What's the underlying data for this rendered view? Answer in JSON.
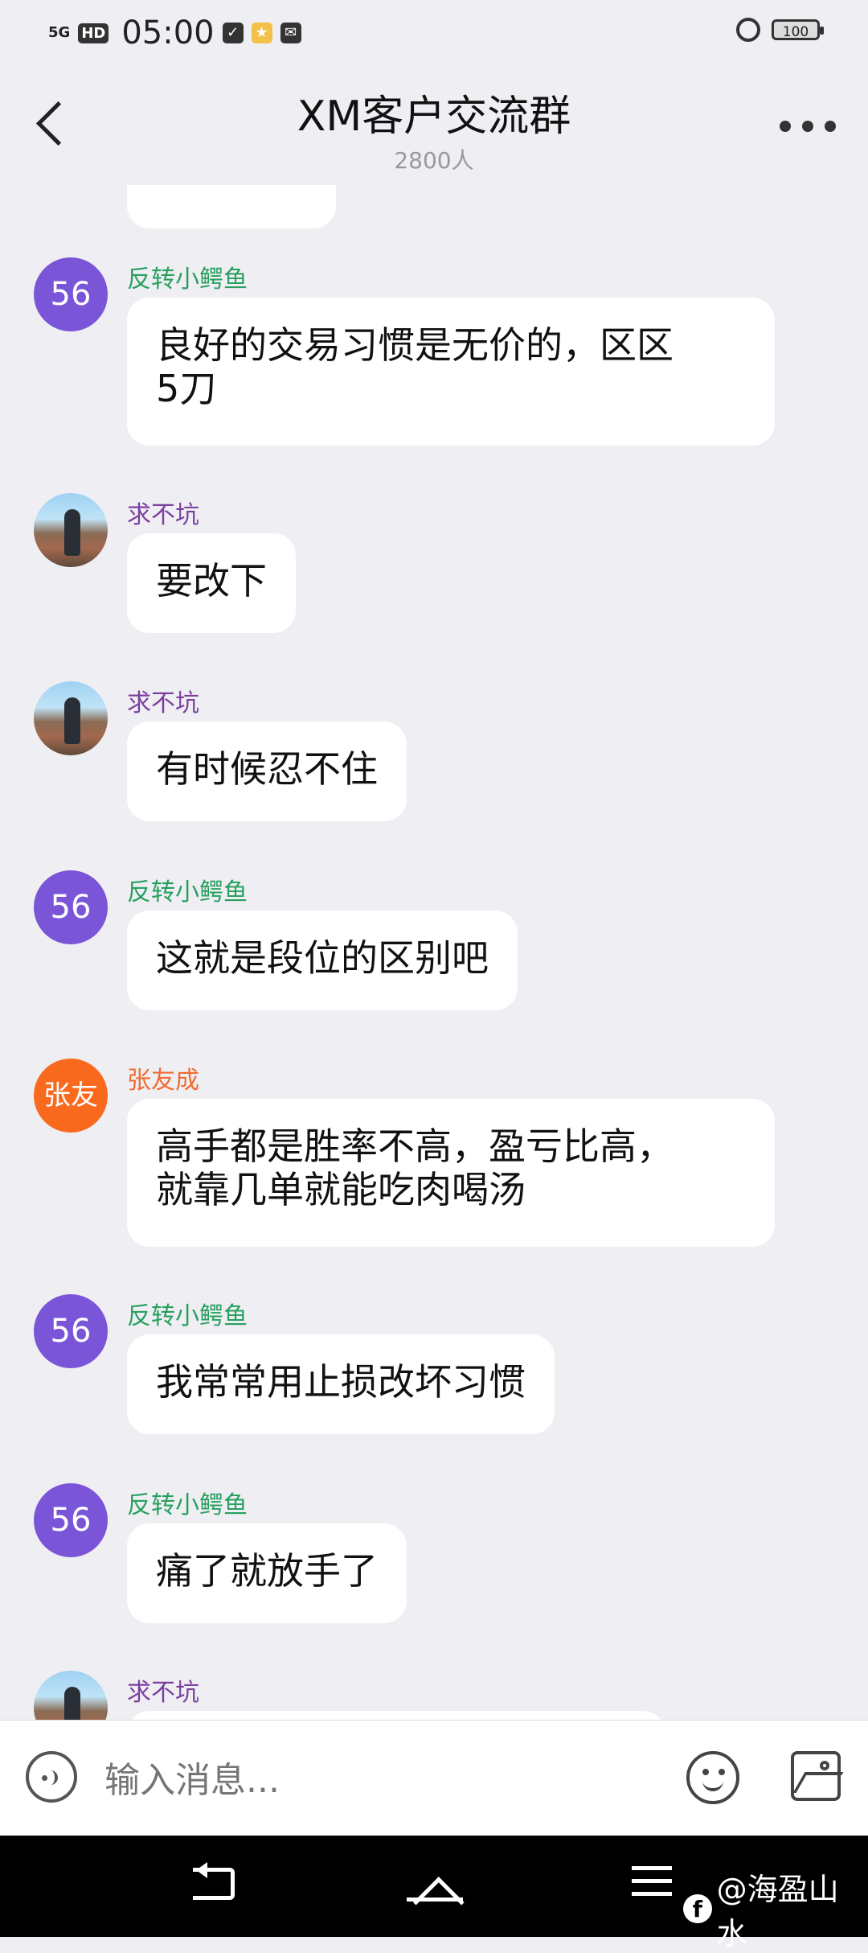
{
  "status_bar": {
    "signal": "5G",
    "hd": "HD",
    "time": "05:00",
    "battery": "100"
  },
  "header": {
    "title": "XM客户交流群",
    "member_count": "2800人"
  },
  "messages": [
    {
      "sender": "反转小鳄鱼",
      "avatar_text": "56",
      "text": "良好的交易习惯是无价的，区区\n5刀"
    },
    {
      "sender": "求不坑",
      "avatar_text": "",
      "text": "要改下"
    },
    {
      "sender": "求不坑",
      "avatar_text": "",
      "text": "有时候忍不住"
    },
    {
      "sender": "反转小鳄鱼",
      "avatar_text": "56",
      "text": "这就是段位的区别吧"
    },
    {
      "sender": "张友成",
      "avatar_text": "张友",
      "text": "高手都是胜率不高，盈亏比高，\n就靠几单就能吃肉喝汤"
    },
    {
      "sender": "反转小鳄鱼",
      "avatar_text": "56",
      "text": "我常常用止损改坏习惯"
    },
    {
      "sender": "反转小鳄鱼",
      "avatar_text": "56",
      "text": "痛了就放手了"
    },
    {
      "sender": "求不坑",
      "avatar_text": "",
      "text": ""
    }
  ],
  "input": {
    "placeholder": "输入消息..."
  },
  "navbar": {
    "watermark": "@海盈山水",
    "watermark_icon": "f"
  }
}
